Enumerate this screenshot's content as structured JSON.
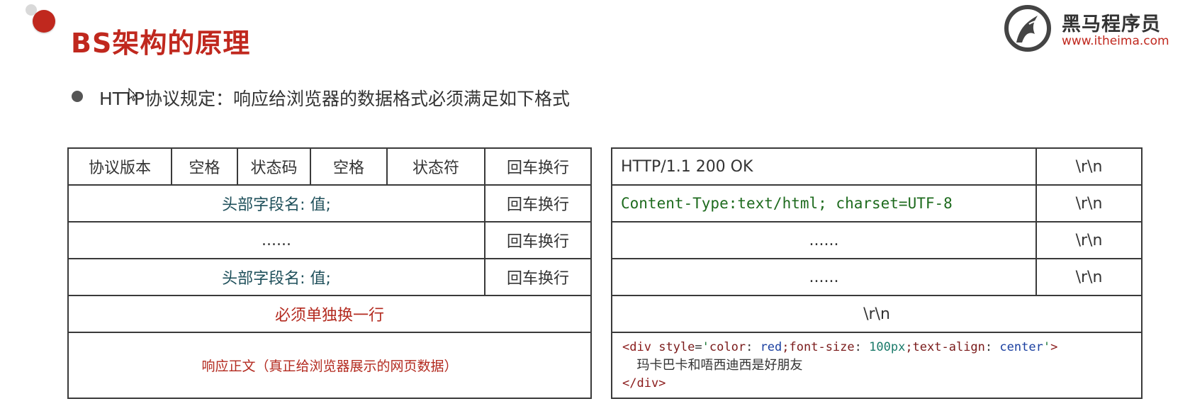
{
  "slide": {
    "title": "BS架构的原理",
    "logo": {
      "name": "黑马程序员",
      "url": "www.itheima.com"
    },
    "bullet": "HTTP协议规定：响应给浏览器的数据格式必须满足如下格式"
  },
  "left_table": {
    "status_row": [
      "协议版本",
      "空格",
      "状态码",
      "空格",
      "状态符",
      "回车换行"
    ],
    "rows": [
      {
        "content": "头部字段名: 值;",
        "end": "回车换行"
      },
      {
        "content": "......",
        "end": "回车换行"
      },
      {
        "content": "头部字段名: 值;",
        "end": "回车换行"
      }
    ],
    "blank_line": "必须单独换一行",
    "body": "响应正文（真正给浏览器展示的网页数据）"
  },
  "right_table": {
    "rows": [
      {
        "content": "HTTP/1.1 200 OK",
        "end": "\\r\\n"
      },
      {
        "content": "Content-Type:text/html; charset=UTF-8",
        "end": "\\r\\n"
      },
      {
        "content": "......",
        "end": "\\r\\n"
      },
      {
        "content": "......",
        "end": "\\r\\n"
      }
    ],
    "blank_line": "\\r\\n",
    "code": {
      "open_tag_start": "<div",
      "attr_name": "style",
      "eq": "=",
      "quote_open": "'",
      "p1_name": "color",
      "p1_colon": ": ",
      "p1_value": "red",
      "p2_name": ";font-size",
      "p2_colon": ": ",
      "p2_value": "100px",
      "p3_name": ";text-align",
      "p3_colon": ": ",
      "p3_value": "center",
      "quote_close": "'",
      "open_tag_end": ">",
      "text": "玛卡巴卡和唔西迪西是好朋友",
      "close_tag": "</div>"
    }
  },
  "colors": {
    "title_red": "#c0281e",
    "header_blue": "#1e4f5a",
    "code_green": "#1e6b1e"
  }
}
